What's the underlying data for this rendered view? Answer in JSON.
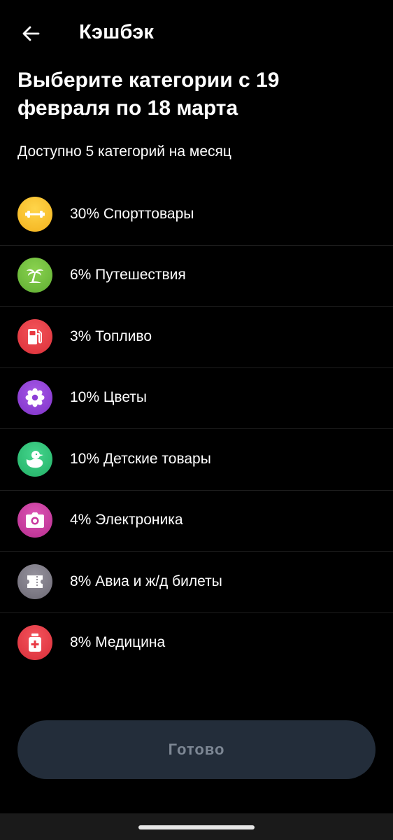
{
  "header": {
    "title": "Кэшбэк",
    "back_icon": "arrow-left-icon"
  },
  "headline": "Выберите категории с 19 февраля по 18 марта",
  "subtitle": "Доступно 5 категорий на месяц",
  "categories": [
    {
      "label": "30% Спорттовары",
      "icon": "dumbbell-icon",
      "color": "#f5b91f"
    },
    {
      "label": "6% Путешествия",
      "icon": "palm-tree-icon",
      "color": "#6cbf3e"
    },
    {
      "label": "3% Топливо",
      "icon": "fuel-pump-icon",
      "color": "#e8383f"
    },
    {
      "label": "10% Цветы",
      "icon": "flower-icon",
      "color": "#8d3fd6"
    },
    {
      "label": "10% Детские товары",
      "icon": "duck-icon",
      "color": "#30c27a"
    },
    {
      "label": "4% Электроника",
      "icon": "camera-icon",
      "color": "#c93aa0"
    },
    {
      "label": "8% Авиа и ж/д билеты",
      "icon": "ticket-icon",
      "color": "#7e7b86"
    },
    {
      "label": "8% Медицина",
      "icon": "medicine-icon",
      "color": "#e93a45"
    }
  ],
  "done_button": {
    "label": "Готово"
  },
  "colors": {
    "background": "#000000",
    "button_bg": "#232d3a",
    "button_text": "#7d8794"
  }
}
